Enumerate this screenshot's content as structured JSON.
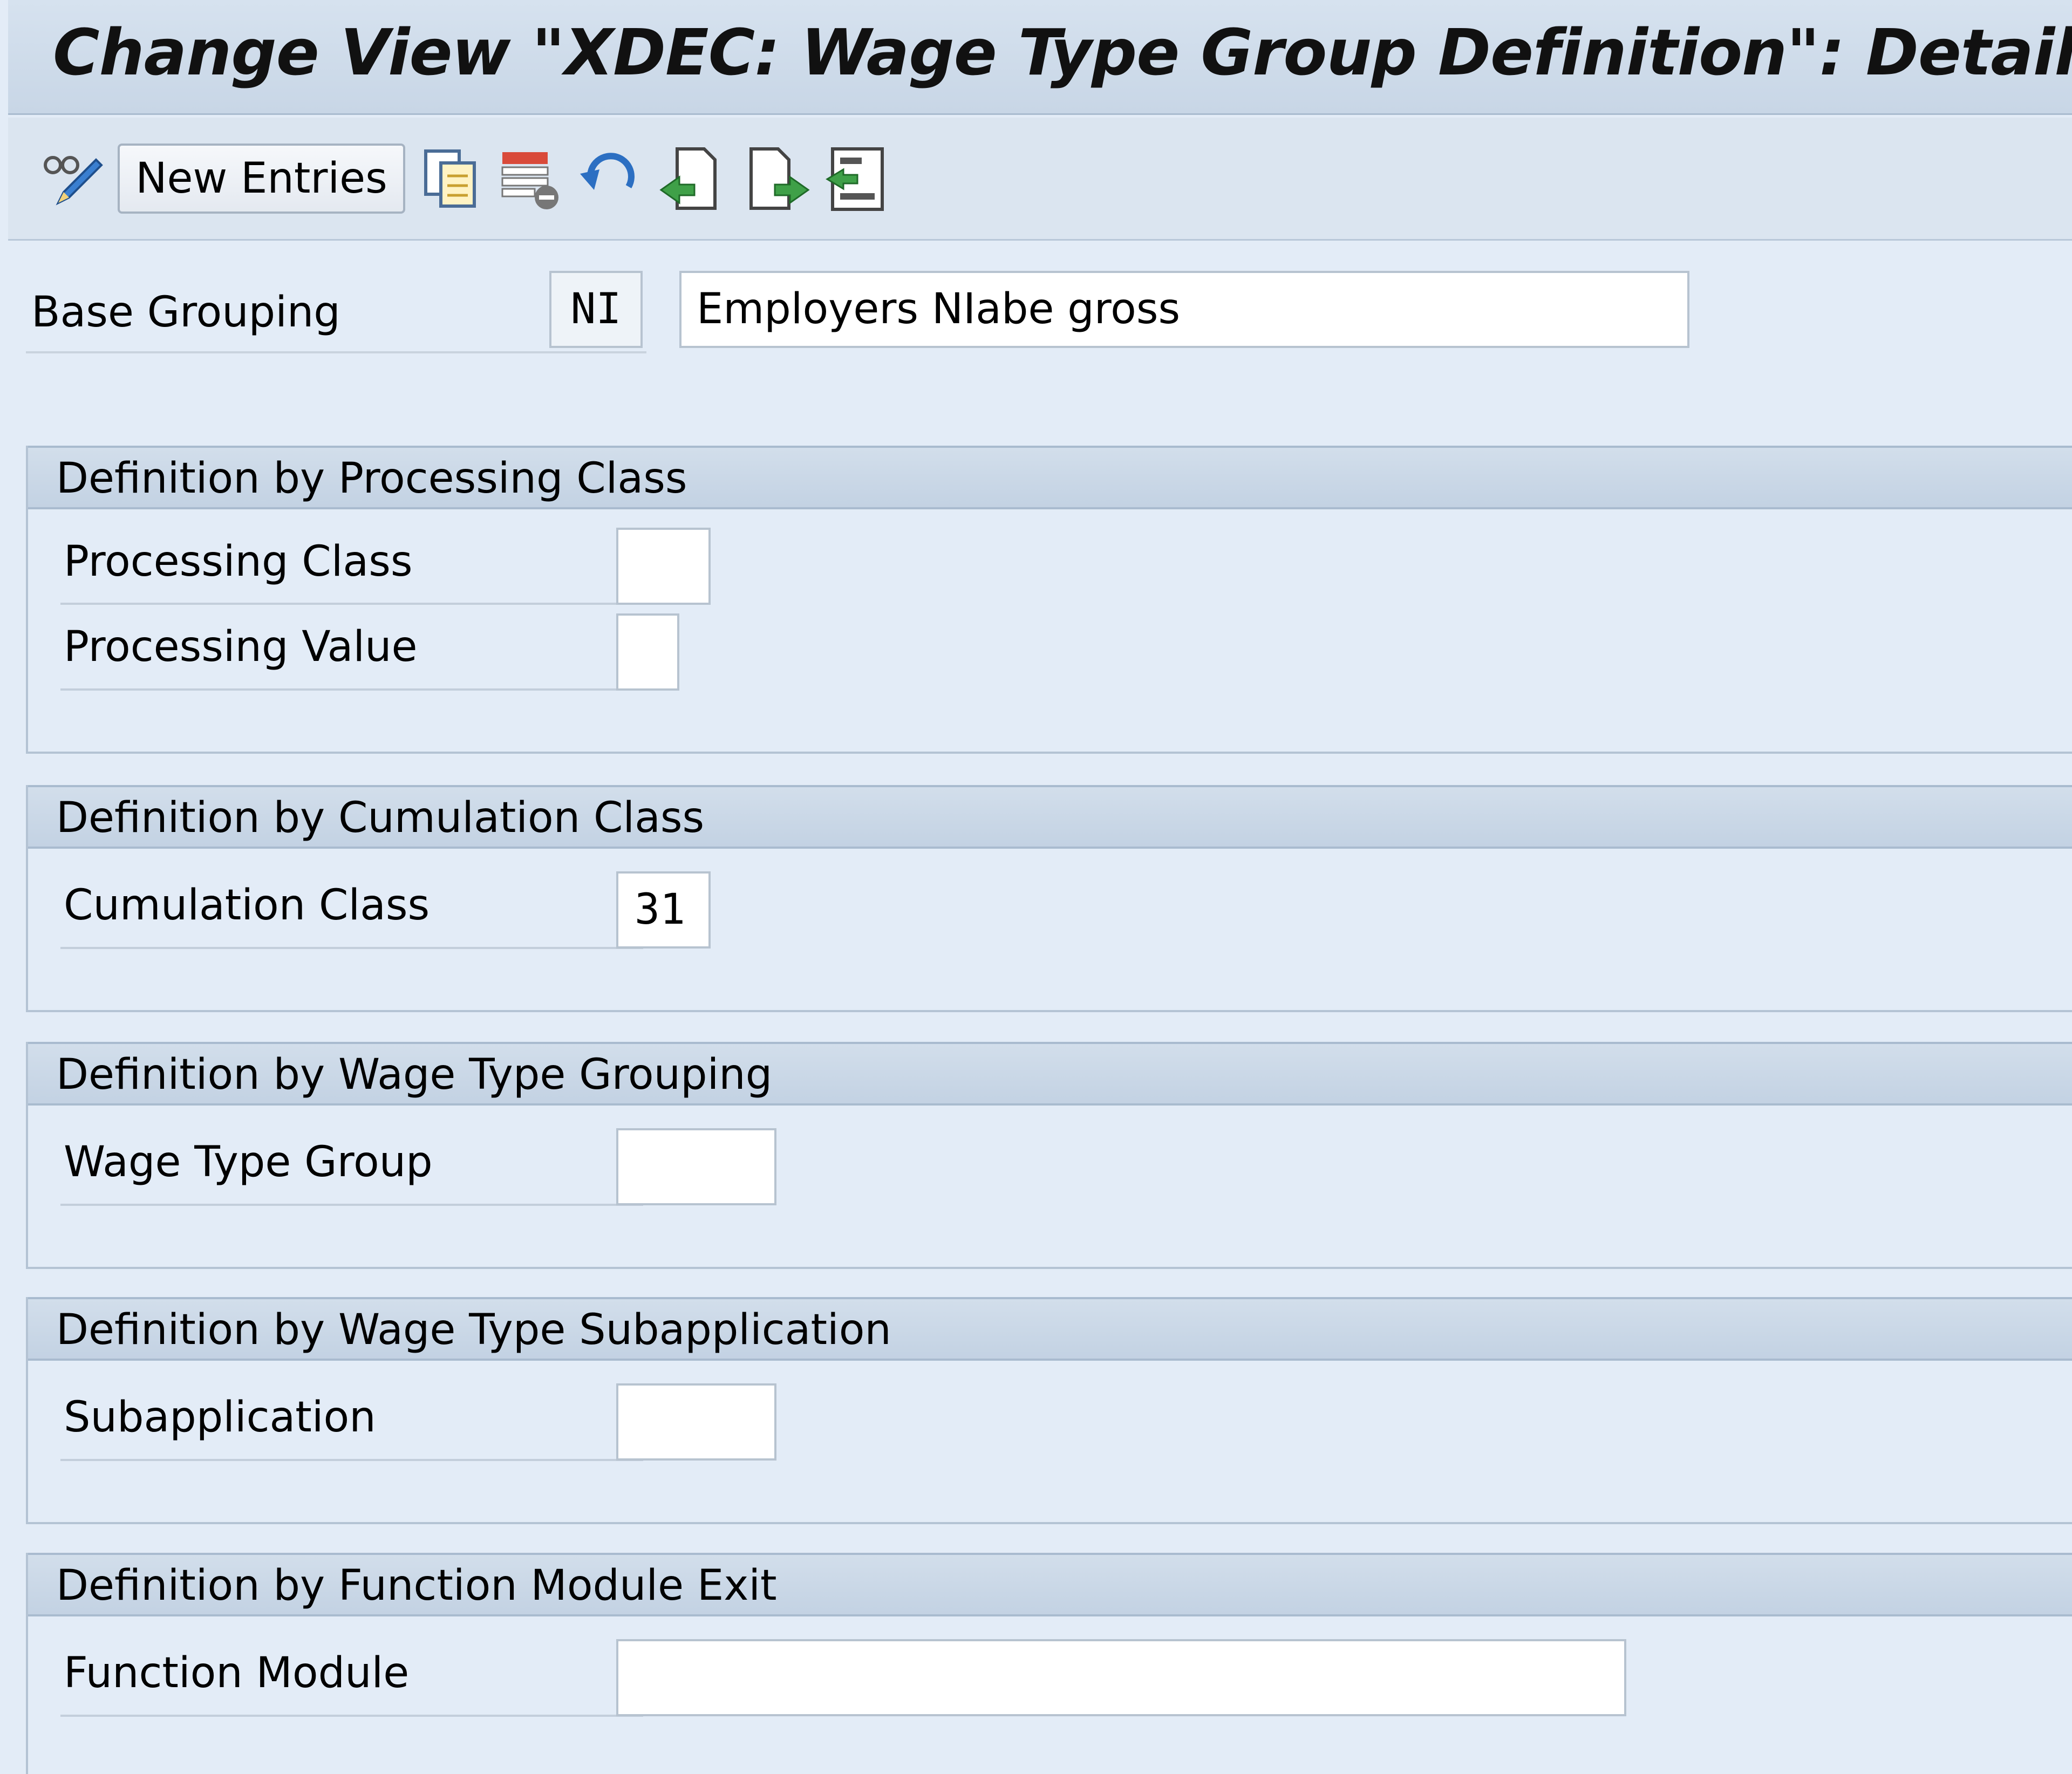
{
  "title": "Change View \"XDEC: Wage Type Group Definition\": Details",
  "toolbar": {
    "new_entries_label": "New Entries",
    "icons": [
      "display-change-icon",
      "copy-icon",
      "delete-icon",
      "undo-icon",
      "previous-entry-icon",
      "next-entry-icon",
      "select-all-icon"
    ]
  },
  "base": {
    "label": "Base Grouping",
    "code": "NI",
    "description": "Employers NIabe gross"
  },
  "sections": {
    "processing": {
      "title": "Definition by Processing Class",
      "class_label": "Processing Class",
      "class_value": "",
      "value_label": "Processing Value",
      "value_value": ""
    },
    "cumulation": {
      "title": "Definition by Cumulation Class",
      "class_label": "Cumulation Class",
      "class_value": "31"
    },
    "wagetype": {
      "title": "Definition by Wage Type Grouping",
      "group_label": "Wage Type Group",
      "group_value": ""
    },
    "subapplication": {
      "title": "Definition by Wage Type Subapplication",
      "sub_label": "Subapplication",
      "sub_value": ""
    },
    "function_module": {
      "title": "Definition by Function Module Exit",
      "fm_label": "Function Module",
      "fm_value": ""
    }
  },
  "colors": {
    "background": "#e3ecf7",
    "header": "#c8d6e6",
    "field": "#ffffff"
  }
}
